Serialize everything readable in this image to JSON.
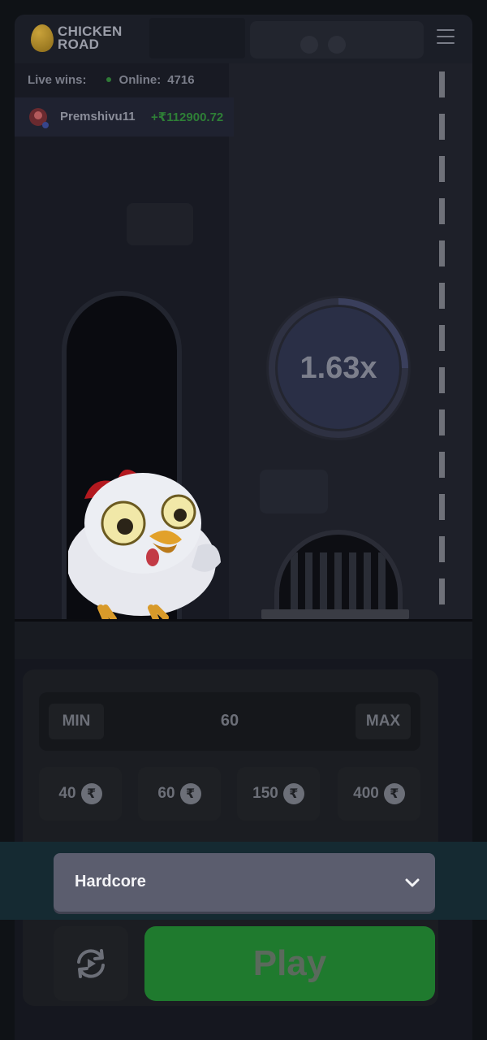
{
  "header": {
    "logo_line1": "CHICKEN",
    "logo_line2": "ROAD",
    "menu_icon": "hamburger-menu-icon"
  },
  "live": {
    "live_wins_label": "Live wins:",
    "online_label": "Online:",
    "online_count": "4716",
    "latest_win": {
      "user": "Premshivu11",
      "amount": "+₹112900.72"
    }
  },
  "game": {
    "multiplier": "1.63x"
  },
  "bet": {
    "min_label": "MIN",
    "max_label": "MAX",
    "amount": "60",
    "currency_icon": "rupee-icon",
    "chips": [
      {
        "value": "40"
      },
      {
        "value": "60"
      },
      {
        "value": "150"
      },
      {
        "value": "400"
      }
    ]
  },
  "difficulty": {
    "selected": "Hardcore"
  },
  "actions": {
    "play_label": "Play",
    "auto_icon": "repeat-icon"
  },
  "colors": {
    "play_green": "#1f7a2e",
    "win_green": "#2e7f36",
    "difficulty_bg": "#5b5d6e"
  }
}
